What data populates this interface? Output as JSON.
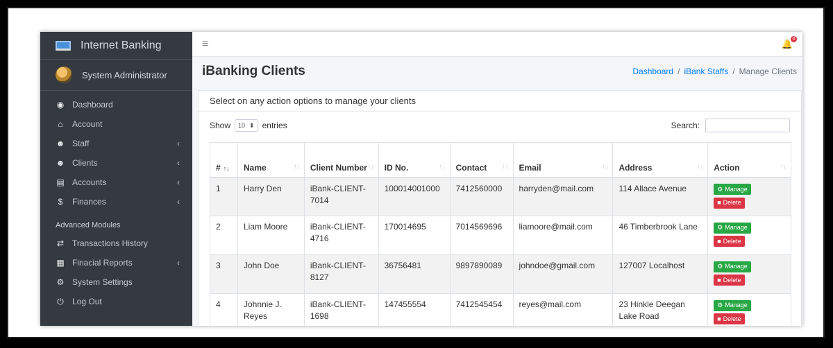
{
  "sidebar": {
    "brand": "Internet Banking",
    "user": "System Administrator",
    "items": [
      {
        "label": "Dashboard",
        "icon": "dashboard-icon",
        "glyph": "◉",
        "chevron": ""
      },
      {
        "label": "Account",
        "icon": "bank-icon",
        "glyph": "⌂",
        "chevron": ""
      },
      {
        "label": "Staff",
        "icon": "user-tie-icon",
        "glyph": "☻",
        "chevron": "‹"
      },
      {
        "label": "Clients",
        "icon": "users-icon",
        "glyph": "☻",
        "chevron": "‹"
      },
      {
        "label": "Accounts",
        "icon": "briefcase-icon",
        "glyph": "▤",
        "chevron": "‹"
      },
      {
        "label": "Finances",
        "icon": "dollar-icon",
        "glyph": "$",
        "chevron": "‹"
      }
    ],
    "section_header": "Advanced Modules",
    "advanced_items": [
      {
        "label": "Transactions History",
        "icon": "exchange-icon",
        "glyph": "⇄",
        "chevron": ""
      },
      {
        "label": "Finacial Reports",
        "icon": "file-icon",
        "glyph": "▦",
        "chevron": "‹"
      },
      {
        "label": "System Settings",
        "icon": "cogs-icon",
        "glyph": "⚙",
        "chevron": ""
      },
      {
        "label": "Log Out",
        "icon": "power-icon",
        "glyph": "⏻",
        "chevron": ""
      }
    ]
  },
  "topbar": {
    "menu_icon": "≡",
    "bell_badge": "0"
  },
  "page": {
    "title": "iBanking Clients",
    "breadcrumb": [
      "Dashboard",
      "iBank Staffs",
      "Manage Clients"
    ],
    "breadcrumb_separator": "/",
    "card_header": "Select on any action options to manage your clients",
    "show_label": "Show",
    "entries_value": "10",
    "entries_label": "entries",
    "search_label": "Search:",
    "search_value": ""
  },
  "table": {
    "columns": [
      "#",
      "Name",
      "Client Number",
      "ID No.",
      "Contact",
      "Email",
      "Address",
      "Action"
    ],
    "rows": [
      {
        "num": "1",
        "name": "Harry Den",
        "client_number": "iBank-CLIENT-7014",
        "id_no": "100014001000",
        "contact": "7412560000",
        "email": "harryden@mail.com",
        "address": "114 Allace Avenue"
      },
      {
        "num": "2",
        "name": "Liam Moore",
        "client_number": "iBank-CLIENT-4716",
        "id_no": "170014695",
        "contact": "7014569696",
        "email": "liamoore@mail.com",
        "address": "46 Timberbrook Lane"
      },
      {
        "num": "3",
        "name": "John Doe",
        "client_number": "iBank-CLIENT-8127",
        "id_no": "36756481",
        "contact": "9897890089",
        "email": "johndoe@gmail.com",
        "address": "127007 Localhost"
      },
      {
        "num": "4",
        "name": "Johnnie J. Reyes",
        "client_number": "iBank-CLIENT-1698",
        "id_no": "147455554",
        "contact": "7412545454",
        "email": "reyes@mail.com",
        "address": "23 Hinkle Deegan Lake Road"
      }
    ],
    "manage_label": "Manage",
    "delete_label": "Delete"
  },
  "colors": {
    "sidebar": "#343a40",
    "manage": "#28a745",
    "delete": "#dc3545",
    "link": "#007bff"
  }
}
